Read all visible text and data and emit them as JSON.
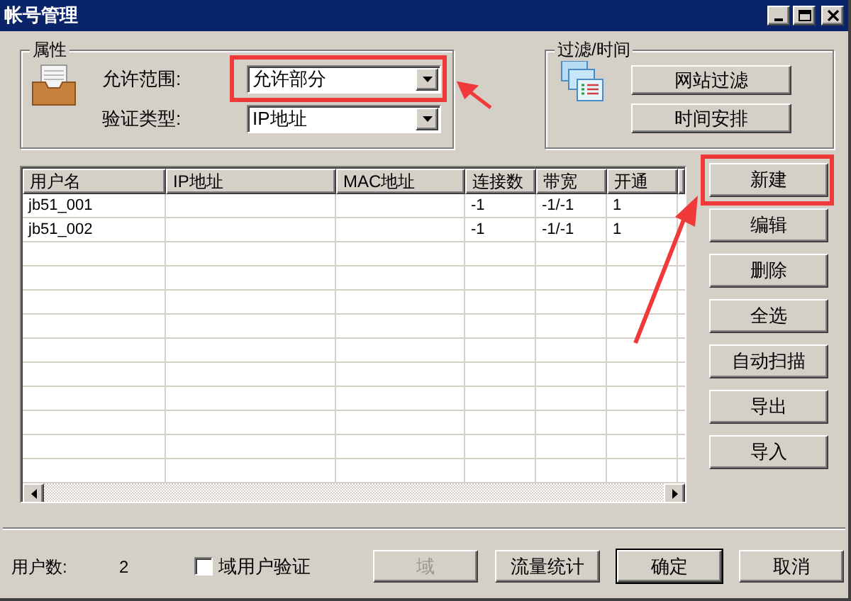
{
  "window": {
    "title": "帐号管理"
  },
  "properties": {
    "title": "属性",
    "fields": [
      {
        "label": "允许范围:",
        "value": "允许部分",
        "highlighted": true
      },
      {
        "label": "验证类型:",
        "value": "IP地址",
        "highlighted": false
      }
    ]
  },
  "filter": {
    "title": "过滤/时间",
    "buttons": [
      "网站过滤",
      "时间安排"
    ]
  },
  "table": {
    "columns": [
      "用户名",
      "IP地址",
      "MAC地址",
      "连接数",
      "带宽",
      "开通"
    ],
    "rows": [
      {
        "username": "jb51_001",
        "connections": "-1",
        "bandwidth": "-1/-1",
        "enabled": "1"
      },
      {
        "username": "jb51_002",
        "connections": "-1",
        "bandwidth": "-1/-1",
        "enabled": "1"
      }
    ]
  },
  "side_buttons": [
    {
      "label": "新建",
      "highlighted": true
    },
    {
      "label": "编辑",
      "highlighted": false
    },
    {
      "label": "删除",
      "highlighted": false
    },
    {
      "label": "全选",
      "highlighted": false
    },
    {
      "label": "自动扫描",
      "highlighted": false
    },
    {
      "label": "导出",
      "highlighted": false
    },
    {
      "label": "导入",
      "highlighted": false
    }
  ],
  "footer": {
    "user_count_label": "用户数:",
    "user_count": "2",
    "checkbox": {
      "label": "域用户验证",
      "checked": false
    },
    "buttons": [
      {
        "label": "域",
        "disabled": true,
        "default": false
      },
      {
        "label": "流量统计",
        "disabled": false,
        "default": false
      },
      {
        "label": "确定",
        "disabled": false,
        "default": true
      },
      {
        "label": "取消",
        "disabled": false,
        "default": false
      }
    ]
  }
}
